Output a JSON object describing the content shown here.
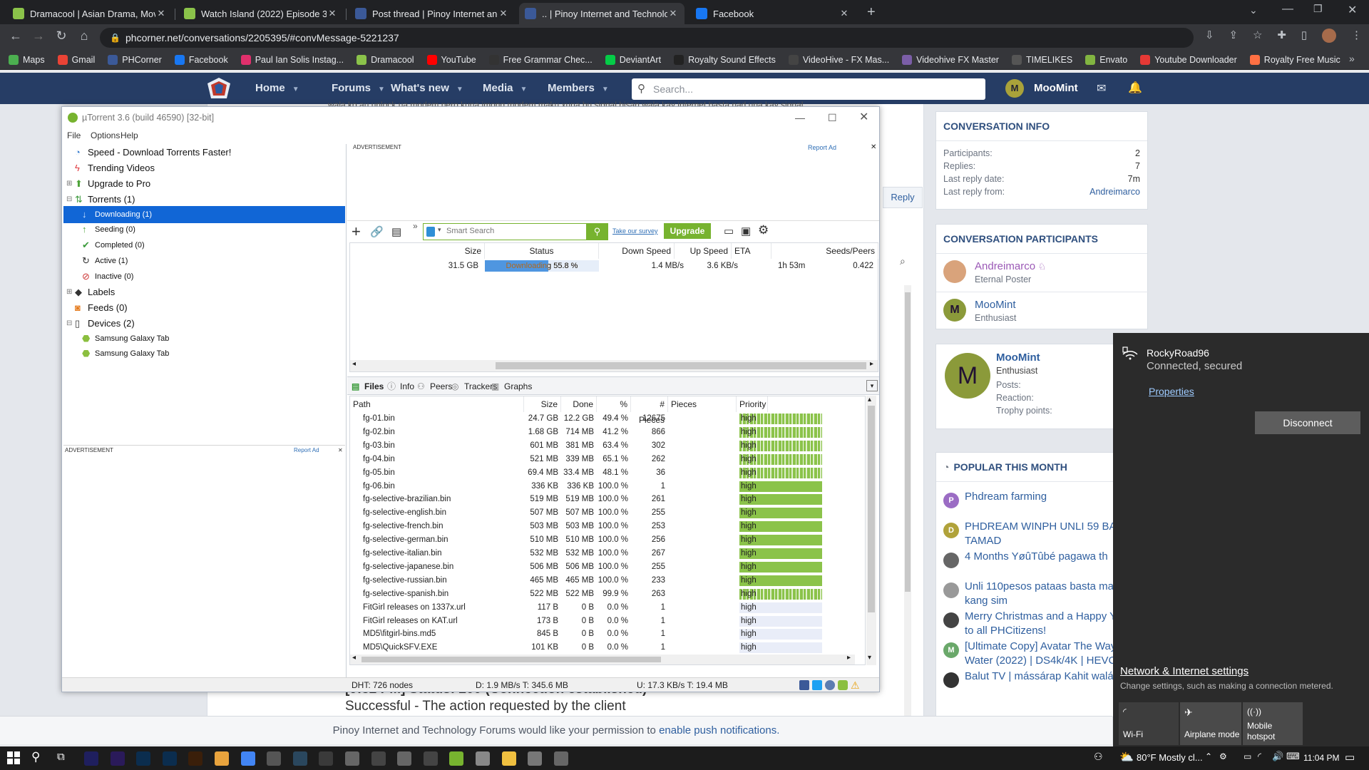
{
  "browser": {
    "tabs": [
      {
        "title": "Dramacool | Asian Drama, Movie",
        "icon": "dramacool-favicon",
        "color": "#8bc34a"
      },
      {
        "title": "Watch Island (2022) Episode 3 O",
        "icon": "dramacool-favicon",
        "color": "#8bc34a"
      },
      {
        "title": "Post thread | Pinoy Internet and",
        "icon": "phcorner-favicon",
        "color": "#3b5998"
      },
      {
        "title": ".. | Pinoy Internet and Technolog",
        "icon": "phcorner-favicon",
        "color": "#3b5998"
      },
      {
        "title": "Facebook",
        "icon": "facebook-favicon",
        "color": "#1877f2"
      }
    ],
    "url": "phcorner.net/conversations/2205395/#convMessage-5221237",
    "bookmarks": [
      {
        "label": "Maps",
        "color": "#4caf50"
      },
      {
        "label": "Gmail",
        "color": "#ea4335"
      },
      {
        "label": "PHCorner",
        "color": "#3b5998"
      },
      {
        "label": "Facebook",
        "color": "#1877f2"
      },
      {
        "label": "Paul Ian Solis Instag...",
        "color": "#e1306c"
      },
      {
        "label": "Dramacool",
        "color": "#8bc34a"
      },
      {
        "label": "YouTube",
        "color": "#ff0000"
      },
      {
        "label": "Free Grammar Chec...",
        "color": "#333333"
      },
      {
        "label": "DeviantArt",
        "color": "#05cc47"
      },
      {
        "label": "Royalty Sound Effects",
        "color": "#222222"
      },
      {
        "label": "VideoHive - FX Mas...",
        "color": "#444444"
      },
      {
        "label": "Videohive FX Master",
        "color": "#7b5ea7"
      },
      {
        "label": "TIMELIKES",
        "color": "#555555"
      },
      {
        "label": "Envato",
        "color": "#82b541"
      },
      {
        "label": "Youtube Downloader",
        "color": "#e53935"
      },
      {
        "label": "Royalty Free Music",
        "color": "#ff7043"
      }
    ]
  },
  "forum": {
    "nav": [
      "Home",
      "Forums",
      "What's new",
      "Media",
      "Members"
    ],
    "search_placeholder": "Search...",
    "user": "MooMint",
    "user_initial": "M",
    "bg_text_top": "wala ko au unlock ua modem pero kuna imong modem maku xuna bu signal bisan wala kay internet basta nad una kay signal",
    "reply_label": "Reply",
    "conversation_info": {
      "title": "CONVERSATION INFO",
      "rows": [
        {
          "k": "Participants:",
          "v": "2"
        },
        {
          "k": "Replies:",
          "v": "7"
        },
        {
          "k": "Last reply date:",
          "v": "7m"
        },
        {
          "k": "Last reply from:",
          "v": "Andreimarco"
        }
      ]
    },
    "participants": {
      "title": "CONVERSATION PARTICIPANTS",
      "list": [
        {
          "name": "Andreimarco",
          "role": "Eternal Poster"
        },
        {
          "name": "MooMint",
          "role": "Enthusiast",
          "initial": "M"
        }
      ]
    },
    "profile": {
      "name": "MooMint",
      "role": "Enthusiast",
      "initial": "M",
      "fields": [
        "Posts:",
        "Reaction:",
        "Trophy points:"
      ]
    },
    "popular": {
      "title": "POPULAR THIS MONTH",
      "items": [
        {
          "text": "Phdream farming",
          "initial": "P",
          "color": "#9b6cc4"
        },
        {
          "text": "PHDREAM WINPH UNLI 59 BAWAL TAMAD",
          "initial": "D",
          "color": "#b0a23a"
        },
        {
          "text": "4 Months YøûTûbé pagawa th",
          "initial": "",
          "color": "#666666"
        },
        {
          "text": "Unli 110pesos pataas basta madami kang sim",
          "initial": "",
          "color": "#999999"
        },
        {
          "text": "Merry Christmas and a Happy Year to all PHCitizens!",
          "initial": "",
          "color": "#444444"
        },
        {
          "text": "[Ultimate Copy] Avatar The Way of Water (2022) | DS4k/4K | HEVC",
          "initial": "M",
          "color": "#6aa86a"
        },
        {
          "text": "Balut TV | mássárap Kahit walá",
          "initial": "",
          "color": "#333333"
        }
      ]
    },
    "bg_text_bottom_1": "[9:32 PM] Status: 200 (Connection established)",
    "bg_text_bottom_2": "Successful - The action requested by the client",
    "push_text": "Pinoy Internet and Technology Forums would like your permission to ",
    "push_link": "enable push notifications."
  },
  "utorrent": {
    "title": "µTorrent 3.6  (build 46590) [32-bit]",
    "menu": [
      "File",
      "Options",
      "Help"
    ],
    "sidebar": [
      {
        "label": "Speed - Download Torrents Faster!",
        "icon": "speed-gauge-icon",
        "level": 0,
        "sub": false
      },
      {
        "label": "Trending Videos",
        "icon": "flash-icon",
        "level": 0,
        "sub": false
      },
      {
        "label": "Upgrade to Pro",
        "icon": "upgrade-icon",
        "level": 0,
        "sub": false
      },
      {
        "label": "Torrents (1)",
        "icon": "torrents-icon",
        "level": 0,
        "sub": false
      },
      {
        "label": "Downloading (1)",
        "icon": "download-arrow-icon",
        "level": 1,
        "sub": true,
        "selected": true
      },
      {
        "label": "Seeding (0)",
        "icon": "upload-arrow-icon",
        "level": 1,
        "sub": true
      },
      {
        "label": "Completed (0)",
        "icon": "checkmark-icon",
        "level": 1,
        "sub": true
      },
      {
        "label": "Active (1)",
        "icon": "refresh-icon",
        "level": 1,
        "sub": true
      },
      {
        "label": "Inactive (0)",
        "icon": "inactive-icon",
        "level": 1,
        "sub": true
      },
      {
        "label": "Labels",
        "icon": "label-icon",
        "level": 0,
        "sub": false
      },
      {
        "label": "Feeds (0)",
        "icon": "rss-icon",
        "level": 0,
        "sub": false
      },
      {
        "label": "Devices (2)",
        "icon": "device-icon",
        "level": 0,
        "sub": false
      },
      {
        "label": "Samsung Galaxy Tab",
        "icon": "android-icon",
        "level": 1,
        "sub": true
      },
      {
        "label": "Samsung Galaxy Tab",
        "icon": "android-icon",
        "level": 1,
        "sub": true
      }
    ],
    "advertisement": "ADVERTISEMENT",
    "report_ad": "Report Ad",
    "smart_search_placeholder": "Smart Search",
    "survey_link": "Take our survey",
    "upgrade_button": "Upgrade",
    "torrent_columns": [
      "Size",
      "Status",
      "Down Speed",
      "Up Speed",
      "ETA",
      "Seeds/Peers"
    ],
    "torrent": {
      "size": "31.5 GB",
      "status": "Downloading 55.8 %",
      "progress": 0.558,
      "down": "1.4 MB/s",
      "up": "3.6 KB/s",
      "eta": "1h 53m",
      "ratio": "0.422"
    },
    "detail_tabs": [
      "Files",
      "Info",
      "Peers",
      "Trackers",
      "Graphs"
    ],
    "file_columns": [
      "Path",
      "Size",
      "Done",
      "%",
      "# Pieces",
      "Pieces",
      "Priority"
    ],
    "files": [
      {
        "path": "fg-01.bin",
        "size": "24.7 GB",
        "done": "12.2 GB",
        "pct": "49.4 %",
        "pieces": "12675",
        "fill": 0.494,
        "priority": "high"
      },
      {
        "path": "fg-02.bin",
        "size": "1.68 GB",
        "done": "714 MB",
        "pct": "41.2 %",
        "pieces": "866",
        "fill": 0.412,
        "priority": "high"
      },
      {
        "path": "fg-03.bin",
        "size": "601 MB",
        "done": "381 MB",
        "pct": "63.4 %",
        "pieces": "302",
        "fill": 0.634,
        "priority": "high"
      },
      {
        "path": "fg-04.bin",
        "size": "521 MB",
        "done": "339 MB",
        "pct": "65.1 %",
        "pieces": "262",
        "fill": 0.651,
        "priority": "high"
      },
      {
        "path": "fg-05.bin",
        "size": "69.4 MB",
        "done": "33.4 MB",
        "pct": "48.1 %",
        "pieces": "36",
        "fill": 0.481,
        "priority": "high"
      },
      {
        "path": "fg-06.bin",
        "size": "336 KB",
        "done": "336 KB",
        "pct": "100.0 %",
        "pieces": "1",
        "fill": 1,
        "priority": "high"
      },
      {
        "path": "fg-selective-brazilian.bin",
        "size": "519 MB",
        "done": "519 MB",
        "pct": "100.0 %",
        "pieces": "261",
        "fill": 1,
        "priority": "high"
      },
      {
        "path": "fg-selective-english.bin",
        "size": "507 MB",
        "done": "507 MB",
        "pct": "100.0 %",
        "pieces": "255",
        "fill": 1,
        "priority": "high"
      },
      {
        "path": "fg-selective-french.bin",
        "size": "503 MB",
        "done": "503 MB",
        "pct": "100.0 %",
        "pieces": "253",
        "fill": 1,
        "priority": "high"
      },
      {
        "path": "fg-selective-german.bin",
        "size": "510 MB",
        "done": "510 MB",
        "pct": "100.0 %",
        "pieces": "256",
        "fill": 1,
        "priority": "high"
      },
      {
        "path": "fg-selective-italian.bin",
        "size": "532 MB",
        "done": "532 MB",
        "pct": "100.0 %",
        "pieces": "267",
        "fill": 1,
        "priority": "high"
      },
      {
        "path": "fg-selective-japanese.bin",
        "size": "506 MB",
        "done": "506 MB",
        "pct": "100.0 %",
        "pieces": "255",
        "fill": 1,
        "priority": "high"
      },
      {
        "path": "fg-selective-russian.bin",
        "size": "465 MB",
        "done": "465 MB",
        "pct": "100.0 %",
        "pieces": "233",
        "fill": 1,
        "priority": "high"
      },
      {
        "path": "fg-selective-spanish.bin",
        "size": "522 MB",
        "done": "522 MB",
        "pct": "99.9 %",
        "pieces": "263",
        "fill": 0.999,
        "priority": "high"
      },
      {
        "path": "FitGirl releases on 1337x.url",
        "size": "117 B",
        "done": "0 B",
        "pct": "0.0 %",
        "pieces": "1",
        "fill": 0,
        "priority": "high"
      },
      {
        "path": "FitGirl releases on KAT.url",
        "size": "173 B",
        "done": "0 B",
        "pct": "0.0 %",
        "pieces": "1",
        "fill": 0,
        "priority": "high"
      },
      {
        "path": "MD5\\fitgirl-bins.md5",
        "size": "845 B",
        "done": "0 B",
        "pct": "0.0 %",
        "pieces": "1",
        "fill": 0,
        "priority": "high"
      },
      {
        "path": "MD5\\QuickSFV.EXE",
        "size": "101 KB",
        "done": "0 B",
        "pct": "0.0 %",
        "pieces": "1",
        "fill": 0,
        "priority": "high"
      }
    ],
    "status_dht": "DHT: 726 nodes",
    "status_down": "D: 1.9 MB/s T: 345.6 MB",
    "status_up": "U: 17.3 KB/s T: 19.4 MB"
  },
  "wifi_flyout": {
    "network": "RockyRoad96",
    "state": "Connected, secured",
    "properties": "Properties",
    "disconnect": "Disconnect",
    "settings_link": "Network & Internet settings",
    "settings_desc": "Change settings, such as making a connection metered.",
    "tiles": [
      "Wi-Fi",
      "Airplane mode",
      "Mobile hotspot"
    ]
  },
  "taskbar": {
    "weather": "80°F  Mostly cl...",
    "time": "11:04 PM",
    "apps": [
      {
        "name": "adobe-after-effects-icon",
        "color": "#1f1f5e"
      },
      {
        "name": "adobe-premiere-icon",
        "color": "#2a1a5a"
      },
      {
        "name": "photoshop-icon",
        "color": "#0b2d4e"
      },
      {
        "name": "photoshop-icon",
        "color": "#0b2d4e"
      },
      {
        "name": "illustrator-icon",
        "color": "#3a1f0a"
      },
      {
        "name": "app-icon",
        "color": "#e8a33d"
      },
      {
        "name": "chrome-icon",
        "color": "#4285f4"
      },
      {
        "name": "app-icon",
        "color": "#555555"
      },
      {
        "name": "steam-icon",
        "color": "#2a475e"
      },
      {
        "name": "app-icon",
        "color": "#3a3a3a"
      },
      {
        "name": "app-icon",
        "color": "#666666"
      },
      {
        "name": "app-icon",
        "color": "#444444"
      },
      {
        "name": "app-icon",
        "color": "#666666"
      },
      {
        "name": "app-icon",
        "color": "#444444"
      },
      {
        "name": "utorrent-icon",
        "color": "#77b32f"
      },
      {
        "name": "app-icon",
        "color": "#888888"
      },
      {
        "name": "file-explorer-icon",
        "color": "#f0c040"
      },
      {
        "name": "app-icon",
        "color": "#777777"
      },
      {
        "name": "app-icon",
        "color": "#666666"
      }
    ]
  }
}
